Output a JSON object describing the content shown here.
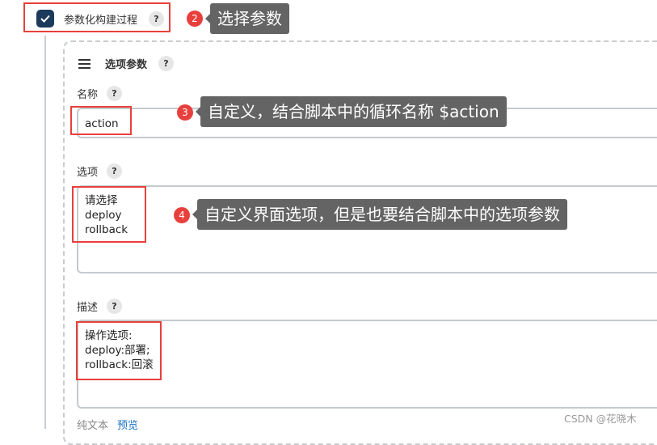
{
  "parameterized": {
    "checked": true,
    "label": "参数化构建过程",
    "help": "?"
  },
  "section": {
    "title": "选项参数",
    "help": "?"
  },
  "fields": {
    "name": {
      "label": "名称",
      "help": "?",
      "value": "action"
    },
    "choices": {
      "label": "选项",
      "help": "?",
      "value": "请选择\ndeploy\nrollback"
    },
    "description": {
      "label": "描述",
      "help": "?",
      "value": "操作选项:\ndeploy:部署;\nrollback:回滚"
    }
  },
  "description_format": {
    "plain": "纯文本",
    "preview": "预览"
  },
  "annotations": [
    {
      "number": "2",
      "text": "选择参数"
    },
    {
      "number": "3",
      "text": "自定义，结合脚本中的循环名称 $action"
    },
    {
      "number": "4",
      "text": "自定义界面选项，但是也要结合脚本中的选项参数"
    }
  ],
  "watermark": "CSDN @花晓木",
  "colors": {
    "checkbox": "#1b3a5c",
    "highlight": "#e8403d",
    "tooltip": "#646464",
    "link": "#1a73c9"
  }
}
